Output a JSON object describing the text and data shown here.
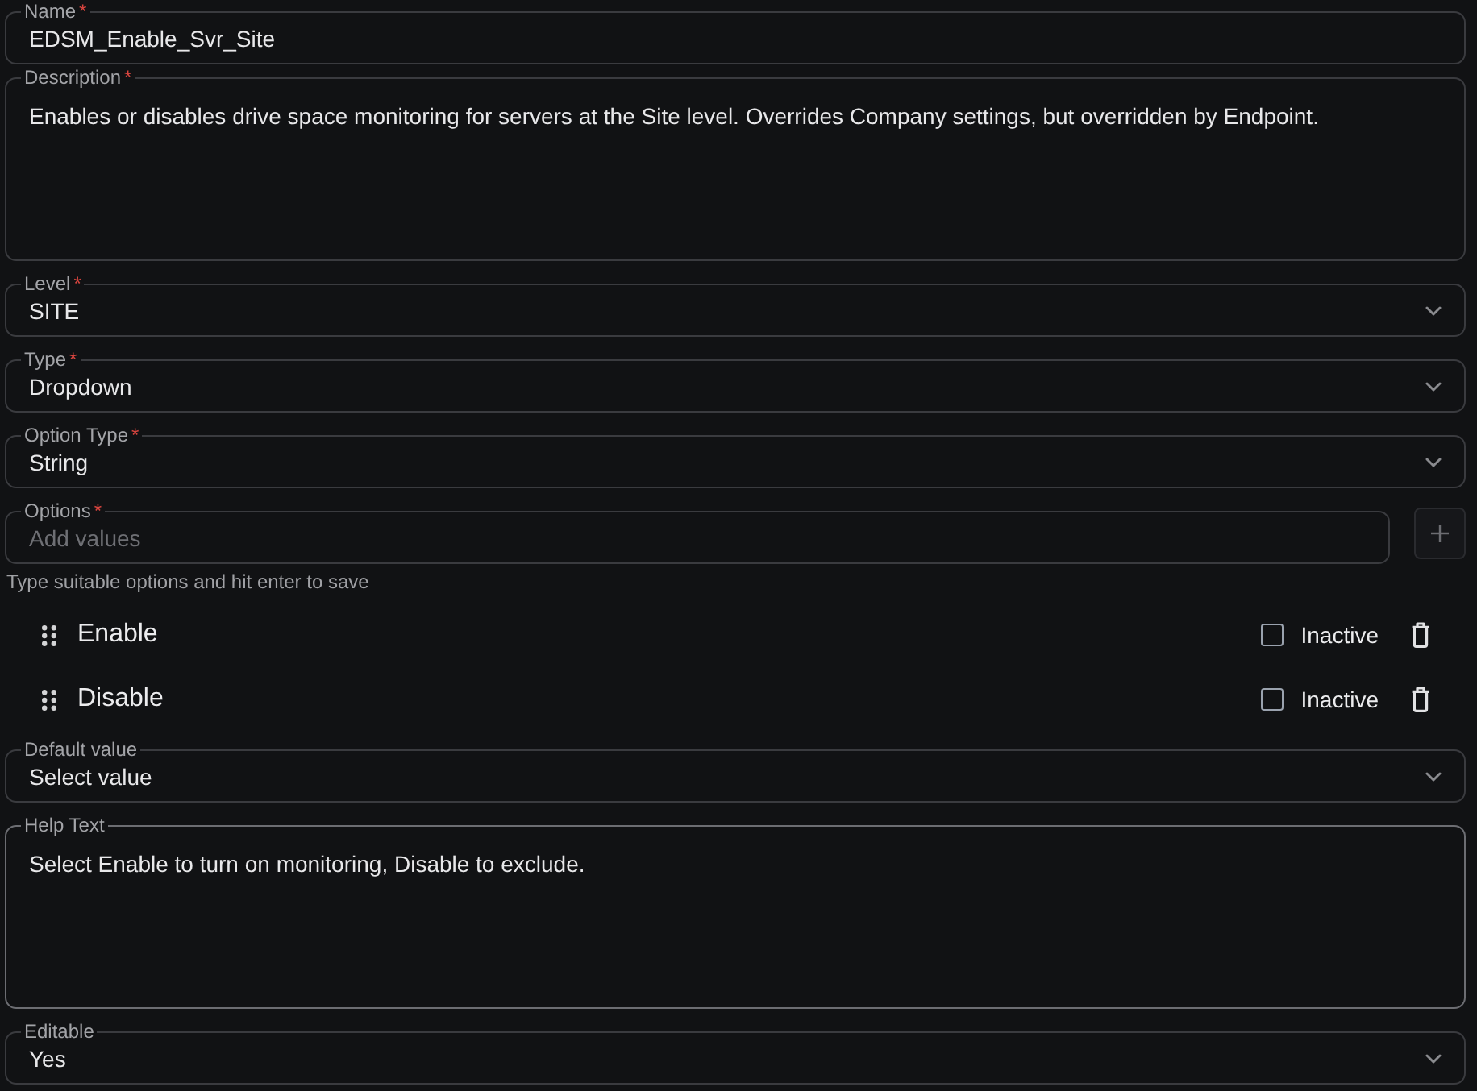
{
  "fields": [
    {
      "kind": "text",
      "label": "Name",
      "required_mark": "*",
      "value": "EDSM_Enable_Svr_Site",
      "focused": false
    },
    {
      "kind": "textarea",
      "label": "Description",
      "required_mark": "*",
      "value": "Enables or disables drive space monitoring for servers at the Site level. Overrides Company settings, but overridden by Endpoint.",
      "focused": false
    },
    {
      "kind": "select",
      "label": "Level",
      "required_mark": "*",
      "value": "SITE",
      "focused": false
    },
    {
      "kind": "select",
      "label": "Type",
      "required_mark": "*",
      "value": "Dropdown",
      "focused": false
    },
    {
      "kind": "select",
      "label": "Option Type",
      "required_mark": "*",
      "value": "String",
      "focused": false
    },
    {
      "kind": "options",
      "label": "Options",
      "required_mark": "*",
      "placeholder": "Add values",
      "focused": false,
      "helper": "Type suitable options and hit enter to save",
      "items": [
        {
          "label": "Enable",
          "inactive": false,
          "inactive_label": "Inactive"
        },
        {
          "label": "Disable",
          "inactive": false,
          "inactive_label": "Inactive"
        }
      ]
    },
    {
      "kind": "select",
      "label": "Default value",
      "value": "Select value",
      "focused": false
    },
    {
      "kind": "textarea",
      "label": "Help Text",
      "value": "Select Enable to turn on monitoring, Disable to exclude.",
      "focused": true
    },
    {
      "kind": "select",
      "label": "Editable",
      "value": "Yes",
      "focused": false
    }
  ]
}
